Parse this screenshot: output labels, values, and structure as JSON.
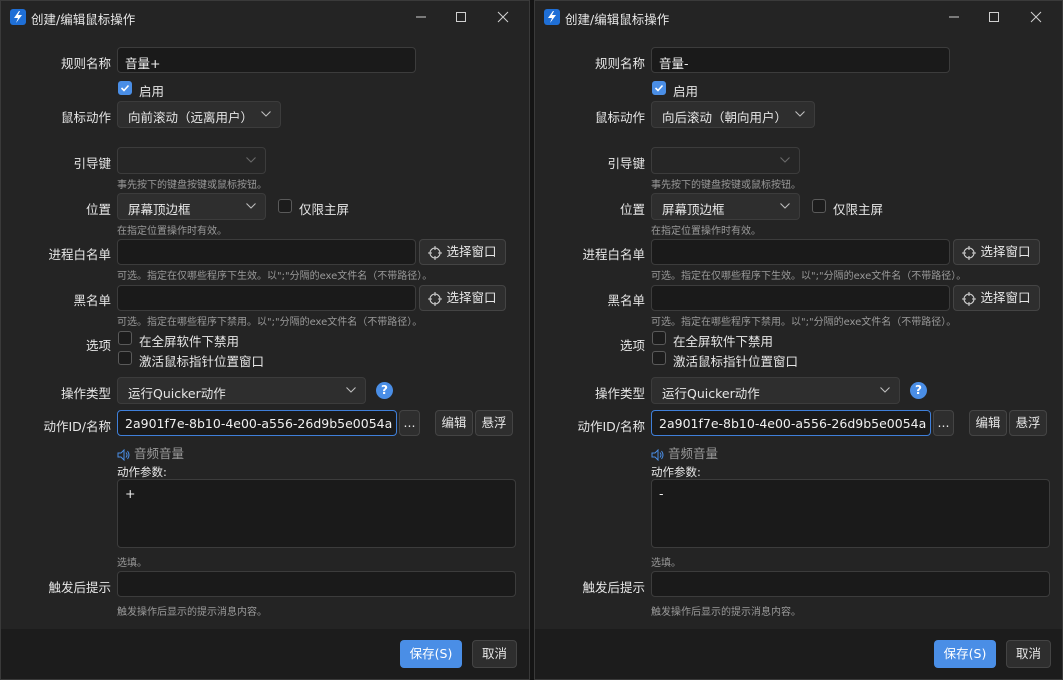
{
  "accent_color": "#4a8ee6",
  "windows": [
    {
      "title": "创建/编辑鼠标操作",
      "rule_name_label": "规则名称",
      "rule_name": "音量+",
      "enable_label": "启用",
      "enabled": true,
      "mouse_action_label": "鼠标动作",
      "mouse_action": "向前滚动（远离用户）",
      "leader_key_label": "引导键",
      "leader_key": "",
      "leader_key_hint": "事先按下的键盘按键或鼠标按钮。",
      "position_label": "位置",
      "position": "屏幕顶边框",
      "primary_screen_only_label": "仅限主屏",
      "primary_screen_only": false,
      "position_hint": "在指定位置操作时有效。",
      "process_whitelist_label": "进程白名单",
      "process_whitelist": "",
      "select_window_label": "选择窗口",
      "process_whitelist_hint": "可选。指定在仅哪些程序下生效。以\";\"分隔的exe文件名（不带路径）。",
      "blacklist_label": "黑名单",
      "blacklist": "",
      "blacklist_hint": "可选。指定在哪些程序下禁用。以\";\"分隔的exe文件名（不带路径）。",
      "options_label": "选项",
      "option_fullscreen_disable": "在全屏软件下禁用",
      "option_activate_window": "激活鼠标指针位置窗口",
      "operation_type_label": "操作类型",
      "operation_type": "运行Quicker动作",
      "action_id_label": "动作ID/名称",
      "action_id": "2a901f7e-8b10-4e00-a556-26d9b5e0054a",
      "more_label": "...",
      "edit_label": "编辑",
      "float_label": "悬浮",
      "action_name": "音频音量",
      "action_params_label": "动作参数:",
      "action_params": "+",
      "action_params_hint": "选填。",
      "trigger_tip_label": "触发后提示",
      "trigger_tip": "",
      "trigger_tip_hint": "触发操作后显示的提示消息内容。",
      "save_label": "保存(S)",
      "cancel_label": "取消"
    },
    {
      "title": "创建/编辑鼠标操作",
      "rule_name_label": "规则名称",
      "rule_name": "音量-",
      "enable_label": "启用",
      "enabled": true,
      "mouse_action_label": "鼠标动作",
      "mouse_action": "向后滚动（朝向用户）",
      "leader_key_label": "引导键",
      "leader_key": "",
      "leader_key_hint": "事先按下的键盘按键或鼠标按钮。",
      "position_label": "位置",
      "position": "屏幕顶边框",
      "primary_screen_only_label": "仅限主屏",
      "primary_screen_only": false,
      "position_hint": "在指定位置操作时有效。",
      "process_whitelist_label": "进程白名单",
      "process_whitelist": "",
      "select_window_label": "选择窗口",
      "process_whitelist_hint": "可选。指定在仅哪些程序下生效。以\";\"分隔的exe文件名（不带路径）。",
      "blacklist_label": "黑名单",
      "blacklist": "",
      "blacklist_hint": "可选。指定在哪些程序下禁用。以\";\"分隔的exe文件名（不带路径）。",
      "options_label": "选项",
      "option_fullscreen_disable": "在全屏软件下禁用",
      "option_activate_window": "激活鼠标指针位置窗口",
      "operation_type_label": "操作类型",
      "operation_type": "运行Quicker动作",
      "action_id_label": "动作ID/名称",
      "action_id": "2a901f7e-8b10-4e00-a556-26d9b5e0054a",
      "more_label": "...",
      "edit_label": "编辑",
      "float_label": "悬浮",
      "action_name": "音频音量",
      "action_params_label": "动作参数:",
      "action_params": "-",
      "action_params_hint": "选填。",
      "trigger_tip_label": "触发后提示",
      "trigger_tip": "",
      "trigger_tip_hint": "触发操作后显示的提示消息内容。",
      "save_label": "保存(S)",
      "cancel_label": "取消"
    }
  ]
}
